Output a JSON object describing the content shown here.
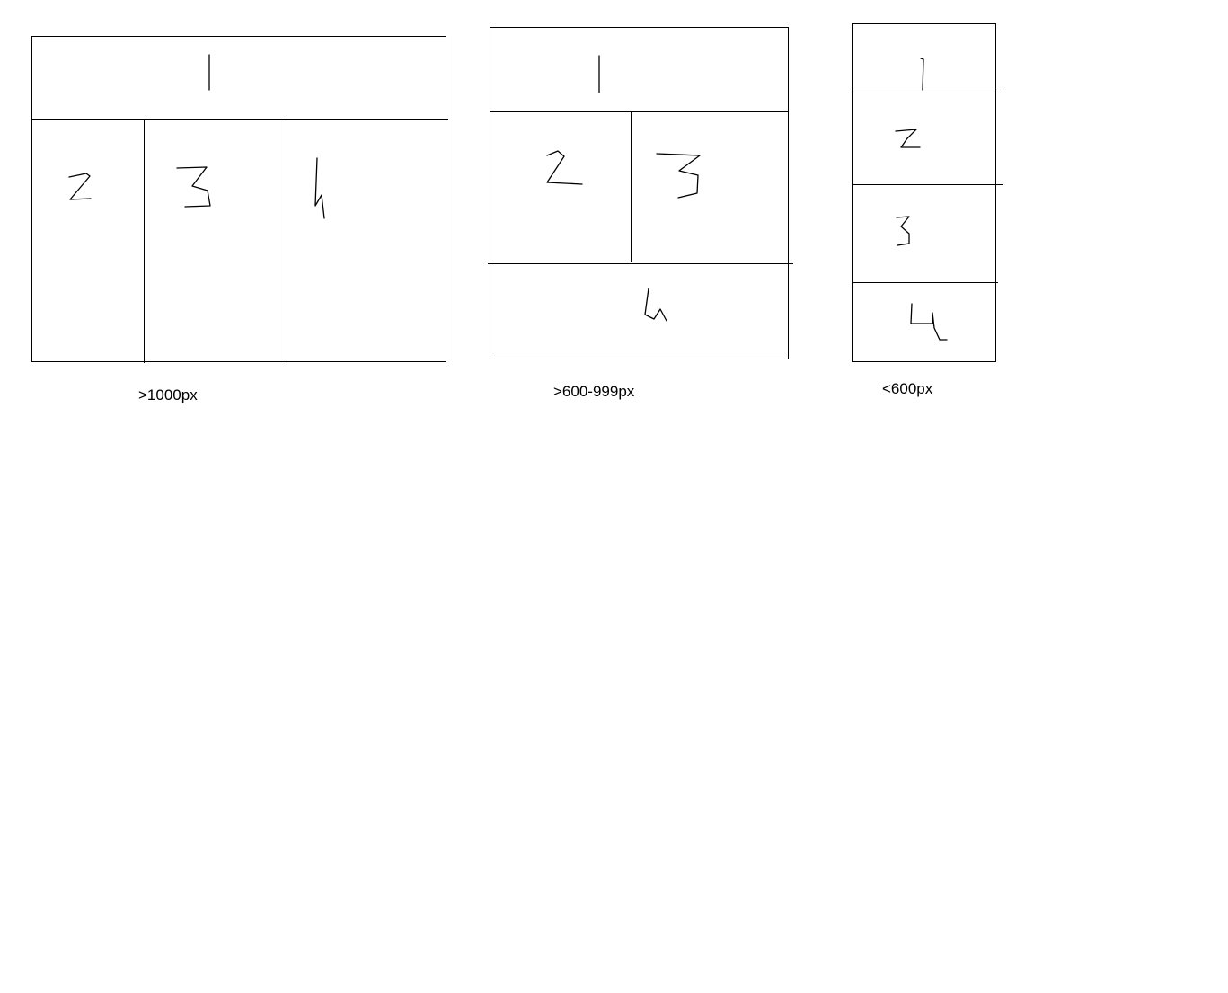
{
  "layouts": [
    {
      "caption": ">1000px",
      "regions": [
        "1",
        "2",
        "3",
        "4"
      ]
    },
    {
      "caption": ">600-999px",
      "regions": [
        "1",
        "2",
        "3",
        "4"
      ]
    },
    {
      "caption": "<600px",
      "regions": [
        "1",
        "2",
        "3",
        "4"
      ]
    }
  ],
  "colors": {
    "ink": "#000000",
    "background": "#ffffff"
  }
}
